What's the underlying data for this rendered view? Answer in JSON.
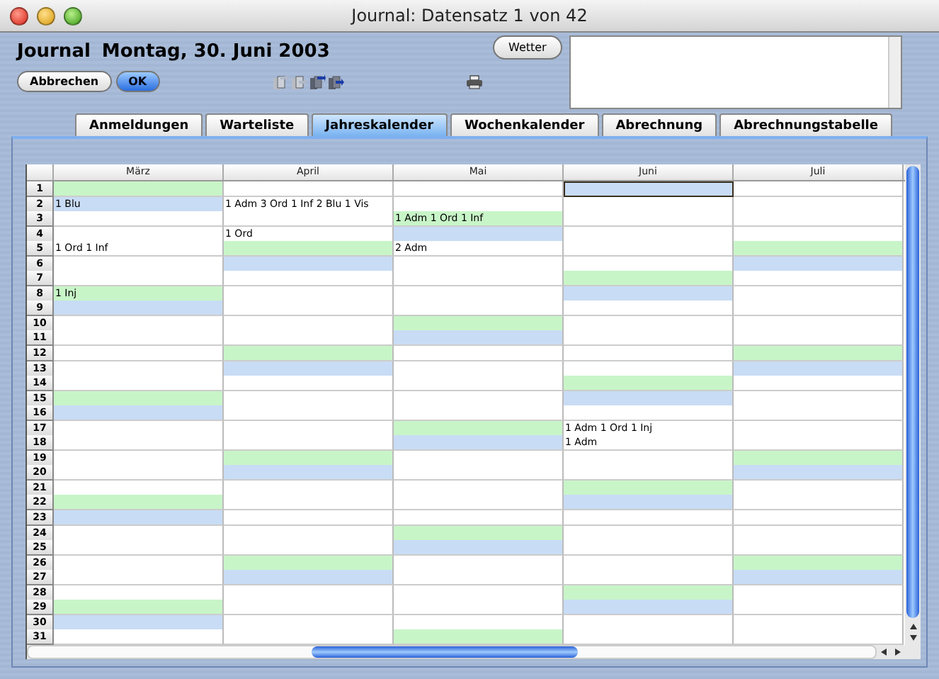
{
  "window": {
    "title": "Journal: Datensatz 1 von 42"
  },
  "header": {
    "title": "Journal",
    "date": "Montag, 30. Juni 2003"
  },
  "buttons": [
    {
      "label": "Abbrechen",
      "default": false
    },
    {
      "label": "OK",
      "default": true
    }
  ],
  "record_tools": [
    {
      "disabled": true
    },
    {
      "disabled": true
    },
    {
      "disabled": false
    },
    {
      "disabled": false
    }
  ],
  "weather_button": {
    "label": "Wetter"
  },
  "tabs": [
    {
      "label": "Anmeldungen",
      "selected": false
    },
    {
      "label": "Warteliste",
      "selected": false
    },
    {
      "label": "Jahreskalender",
      "selected": true
    },
    {
      "label": "Wochenkalender",
      "selected": false
    },
    {
      "label": "Abrechnung",
      "selected": false
    },
    {
      "label": "Abrechnungstabelle",
      "selected": false
    }
  ],
  "table": {
    "columns": [
      "März",
      "April",
      "Mai",
      "Juni",
      "Juli"
    ],
    "rows": [
      {
        "day": "1",
        "cells": [
          {
            "color": "#c8f5c8",
            "selected": false
          },
          {
            "color": "#ffffff",
            "selected": false
          },
          {
            "color": "#ffffff",
            "selected": false
          },
          {
            "color": "#c8dcf5",
            "selected": true
          },
          {
            "color": "#ffffff",
            "selected": false
          }
        ]
      },
      {
        "day": "2",
        "cells": [
          {
            "color": "#c8dcf5",
            "selected": false,
            "text": "1 Blu"
          },
          {
            "color": "#ffffff",
            "selected": false,
            "text": "1 Adm 3 Ord 1 Inf 2 Blu 1 Vis"
          },
          {
            "color": "#ffffff",
            "selected": false
          },
          {
            "color": "#ffffff",
            "selected": false
          },
          {
            "color": "#ffffff",
            "selected": false
          }
        ]
      },
      {
        "day": "3",
        "cells": [
          {
            "color": "#ffffff",
            "selected": false
          },
          {
            "color": "#ffffff",
            "selected": false
          },
          {
            "color": "#c8f5c8",
            "selected": false,
            "text": "1 Adm 1 Ord 1 Inf"
          },
          {
            "color": "#ffffff",
            "selected": false
          },
          {
            "color": "#ffffff",
            "selected": false
          }
        ]
      },
      {
        "day": "4",
        "cells": [
          {
            "color": "#ffffff",
            "selected": false
          },
          {
            "color": "#ffffff",
            "selected": false,
            "text": "1 Ord"
          },
          {
            "color": "#c8dcf5",
            "selected": false
          },
          {
            "color": "#ffffff",
            "selected": false
          },
          {
            "color": "#ffffff",
            "selected": false
          }
        ]
      },
      {
        "day": "5",
        "cells": [
          {
            "color": "#ffffff",
            "selected": false,
            "text": "1 Ord 1 Inf"
          },
          {
            "color": "#c8f5c8",
            "selected": false
          },
          {
            "color": "#ffffff",
            "selected": false,
            "text": "2 Adm"
          },
          {
            "color": "#ffffff",
            "selected": false
          },
          {
            "color": "#c8f5c8",
            "selected": false
          }
        ]
      },
      {
        "day": "6",
        "cells": [
          {
            "color": "#ffffff",
            "selected": false
          },
          {
            "color": "#c8dcf5",
            "selected": false
          },
          {
            "color": "#ffffff",
            "selected": false
          },
          {
            "color": "#ffffff",
            "selected": false
          },
          {
            "color": "#c8dcf5",
            "selected": false
          }
        ]
      },
      {
        "day": "7",
        "cells": [
          {
            "color": "#ffffff",
            "selected": false
          },
          {
            "color": "#ffffff",
            "selected": false
          },
          {
            "color": "#ffffff",
            "selected": false
          },
          {
            "color": "#c8f5c8",
            "selected": false
          },
          {
            "color": "#ffffff",
            "selected": false
          }
        ]
      },
      {
        "day": "8",
        "cells": [
          {
            "color": "#c8f5c8",
            "selected": false,
            "text": "1 Inj"
          },
          {
            "color": "#ffffff",
            "selected": false
          },
          {
            "color": "#ffffff",
            "selected": false
          },
          {
            "color": "#c8dcf5",
            "selected": false
          },
          {
            "color": "#ffffff",
            "selected": false
          }
        ]
      },
      {
        "day": "9",
        "cells": [
          {
            "color": "#c8dcf5",
            "selected": false
          },
          {
            "color": "#ffffff",
            "selected": false
          },
          {
            "color": "#ffffff",
            "selected": false
          },
          {
            "color": "#ffffff",
            "selected": false
          },
          {
            "color": "#ffffff",
            "selected": false
          }
        ]
      },
      {
        "day": "10",
        "cells": [
          {
            "color": "#ffffff",
            "selected": false
          },
          {
            "color": "#ffffff",
            "selected": false
          },
          {
            "color": "#c8f5c8",
            "selected": false
          },
          {
            "color": "#ffffff",
            "selected": false
          },
          {
            "color": "#ffffff",
            "selected": false
          }
        ]
      },
      {
        "day": "11",
        "cells": [
          {
            "color": "#ffffff",
            "selected": false
          },
          {
            "color": "#ffffff",
            "selected": false
          },
          {
            "color": "#c8dcf5",
            "selected": false
          },
          {
            "color": "#ffffff",
            "selected": false
          },
          {
            "color": "#ffffff",
            "selected": false
          }
        ]
      },
      {
        "day": "12",
        "cells": [
          {
            "color": "#ffffff",
            "selected": false
          },
          {
            "color": "#c8f5c8",
            "selected": false
          },
          {
            "color": "#ffffff",
            "selected": false
          },
          {
            "color": "#ffffff",
            "selected": false
          },
          {
            "color": "#c8f5c8",
            "selected": false
          }
        ]
      },
      {
        "day": "13",
        "cells": [
          {
            "color": "#ffffff",
            "selected": false
          },
          {
            "color": "#c8dcf5",
            "selected": false
          },
          {
            "color": "#ffffff",
            "selected": false
          },
          {
            "color": "#ffffff",
            "selected": false
          },
          {
            "color": "#c8dcf5",
            "selected": false
          }
        ]
      },
      {
        "day": "14",
        "cells": [
          {
            "color": "#ffffff",
            "selected": false
          },
          {
            "color": "#ffffff",
            "selected": false
          },
          {
            "color": "#ffffff",
            "selected": false
          },
          {
            "color": "#c8f5c8",
            "selected": false
          },
          {
            "color": "#ffffff",
            "selected": false
          }
        ]
      },
      {
        "day": "15",
        "cells": [
          {
            "color": "#c8f5c8",
            "selected": false
          },
          {
            "color": "#ffffff",
            "selected": false
          },
          {
            "color": "#ffffff",
            "selected": false
          },
          {
            "color": "#c8dcf5",
            "selected": false
          },
          {
            "color": "#ffffff",
            "selected": false
          }
        ]
      },
      {
        "day": "16",
        "cells": [
          {
            "color": "#c8dcf5",
            "selected": false
          },
          {
            "color": "#ffffff",
            "selected": false
          },
          {
            "color": "#ffffff",
            "selected": false
          },
          {
            "color": "#ffffff",
            "selected": false
          },
          {
            "color": "#ffffff",
            "selected": false
          }
        ]
      },
      {
        "day": "17",
        "cells": [
          {
            "color": "#ffffff",
            "selected": false
          },
          {
            "color": "#ffffff",
            "selected": false
          },
          {
            "color": "#c8f5c8",
            "selected": false
          },
          {
            "color": "#ffffff",
            "selected": false,
            "text": "1 Adm 1 Ord 1 Inj"
          },
          {
            "color": "#ffffff",
            "selected": false
          }
        ]
      },
      {
        "day": "18",
        "cells": [
          {
            "color": "#ffffff",
            "selected": false
          },
          {
            "color": "#ffffff",
            "selected": false
          },
          {
            "color": "#c8dcf5",
            "selected": false
          },
          {
            "color": "#ffffff",
            "selected": false,
            "text": "1 Adm"
          },
          {
            "color": "#ffffff",
            "selected": false
          }
        ]
      },
      {
        "day": "19",
        "cells": [
          {
            "color": "#ffffff",
            "selected": false
          },
          {
            "color": "#c8f5c8",
            "selected": false
          },
          {
            "color": "#ffffff",
            "selected": false
          },
          {
            "color": "#ffffff",
            "selected": false
          },
          {
            "color": "#c8f5c8",
            "selected": false
          }
        ]
      },
      {
        "day": "20",
        "cells": [
          {
            "color": "#ffffff",
            "selected": false
          },
          {
            "color": "#c8dcf5",
            "selected": false
          },
          {
            "color": "#ffffff",
            "selected": false
          },
          {
            "color": "#ffffff",
            "selected": false
          },
          {
            "color": "#c8dcf5",
            "selected": false
          }
        ]
      },
      {
        "day": "21",
        "cells": [
          {
            "color": "#ffffff",
            "selected": false
          },
          {
            "color": "#ffffff",
            "selected": false
          },
          {
            "color": "#ffffff",
            "selected": false
          },
          {
            "color": "#c8f5c8",
            "selected": false
          },
          {
            "color": "#ffffff",
            "selected": false
          }
        ]
      },
      {
        "day": "22",
        "cells": [
          {
            "color": "#c8f5c8",
            "selected": false
          },
          {
            "color": "#ffffff",
            "selected": false
          },
          {
            "color": "#ffffff",
            "selected": false
          },
          {
            "color": "#c8dcf5",
            "selected": false
          },
          {
            "color": "#ffffff",
            "selected": false
          }
        ]
      },
      {
        "day": "23",
        "cells": [
          {
            "color": "#c8dcf5",
            "selected": false
          },
          {
            "color": "#ffffff",
            "selected": false
          },
          {
            "color": "#ffffff",
            "selected": false
          },
          {
            "color": "#ffffff",
            "selected": false
          },
          {
            "color": "#ffffff",
            "selected": false
          }
        ]
      },
      {
        "day": "24",
        "cells": [
          {
            "color": "#ffffff",
            "selected": false
          },
          {
            "color": "#ffffff",
            "selected": false
          },
          {
            "color": "#c8f5c8",
            "selected": false
          },
          {
            "color": "#ffffff",
            "selected": false
          },
          {
            "color": "#ffffff",
            "selected": false
          }
        ]
      },
      {
        "day": "25",
        "cells": [
          {
            "color": "#ffffff",
            "selected": false
          },
          {
            "color": "#ffffff",
            "selected": false
          },
          {
            "color": "#c8dcf5",
            "selected": false
          },
          {
            "color": "#ffffff",
            "selected": false
          },
          {
            "color": "#ffffff",
            "selected": false
          }
        ]
      },
      {
        "day": "26",
        "cells": [
          {
            "color": "#ffffff",
            "selected": false
          },
          {
            "color": "#c8f5c8",
            "selected": false
          },
          {
            "color": "#ffffff",
            "selected": false
          },
          {
            "color": "#ffffff",
            "selected": false
          },
          {
            "color": "#c8f5c8",
            "selected": false
          }
        ]
      },
      {
        "day": "27",
        "cells": [
          {
            "color": "#ffffff",
            "selected": false
          },
          {
            "color": "#c8dcf5",
            "selected": false
          },
          {
            "color": "#ffffff",
            "selected": false
          },
          {
            "color": "#ffffff",
            "selected": false
          },
          {
            "color": "#c8dcf5",
            "selected": false
          }
        ]
      },
      {
        "day": "28",
        "cells": [
          {
            "color": "#ffffff",
            "selected": false
          },
          {
            "color": "#ffffff",
            "selected": false
          },
          {
            "color": "#ffffff",
            "selected": false
          },
          {
            "color": "#c8f5c8",
            "selected": false
          },
          {
            "color": "#ffffff",
            "selected": false
          }
        ]
      },
      {
        "day": "29",
        "cells": [
          {
            "color": "#c8f5c8",
            "selected": false
          },
          {
            "color": "#ffffff",
            "selected": false
          },
          {
            "color": "#ffffff",
            "selected": false
          },
          {
            "color": "#c8dcf5",
            "selected": false
          },
          {
            "color": "#ffffff",
            "selected": false
          }
        ]
      },
      {
        "day": "30",
        "cells": [
          {
            "color": "#c8dcf5",
            "selected": false
          },
          {
            "color": "#ffffff",
            "selected": false
          },
          {
            "color": "#ffffff",
            "selected": false
          },
          {
            "color": "#ffffff",
            "selected": false
          },
          {
            "color": "#ffffff",
            "selected": false
          }
        ]
      },
      {
        "day": "31",
        "cells": [
          {
            "color": "#ffffff",
            "selected": false
          },
          {
            "color": "#ffffff",
            "selected": false
          },
          {
            "color": "#c8f5c8",
            "selected": false
          },
          {
            "color": "#ffffff",
            "selected": false
          },
          {
            "color": "#ffffff",
            "selected": false
          }
        ]
      }
    ]
  }
}
